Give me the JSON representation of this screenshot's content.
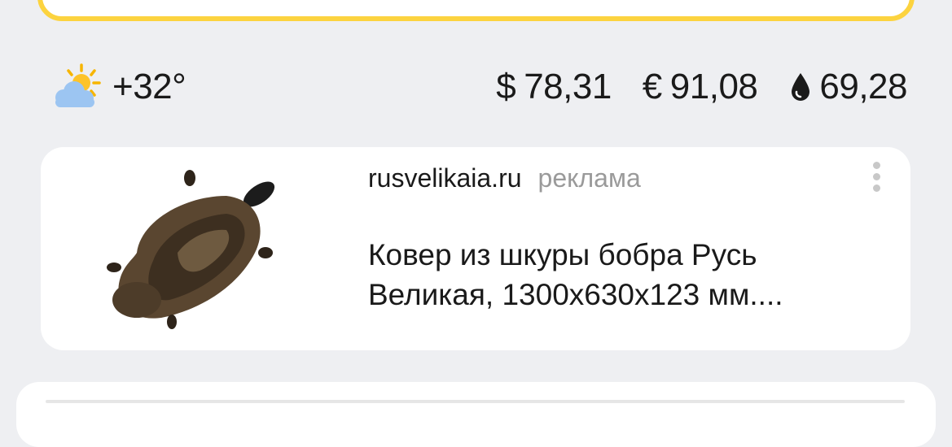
{
  "weather": {
    "icon": "partly-cloudy-icon",
    "temperature": "+32°"
  },
  "rates": [
    {
      "symbol": "$",
      "value": "78,31",
      "icon": "dollar-sign"
    },
    {
      "symbol": "€",
      "value": "91,08",
      "icon": "euro-sign"
    },
    {
      "symbol": "",
      "value": "69,28",
      "icon": "oil-drop-icon"
    }
  ],
  "ad": {
    "domain": "rusvelikaia.ru",
    "label": "реклама",
    "title_line1": "Ковер из шкуры бобра Русь",
    "title_line2": "Великая, 1300x630x123 мм....",
    "image": "beaver-fur-rug-image"
  },
  "colors": {
    "accent_yellow": "#fcd33f",
    "background": "#eeeff2",
    "card": "#ffffff",
    "muted_text": "#9a9a9a"
  }
}
